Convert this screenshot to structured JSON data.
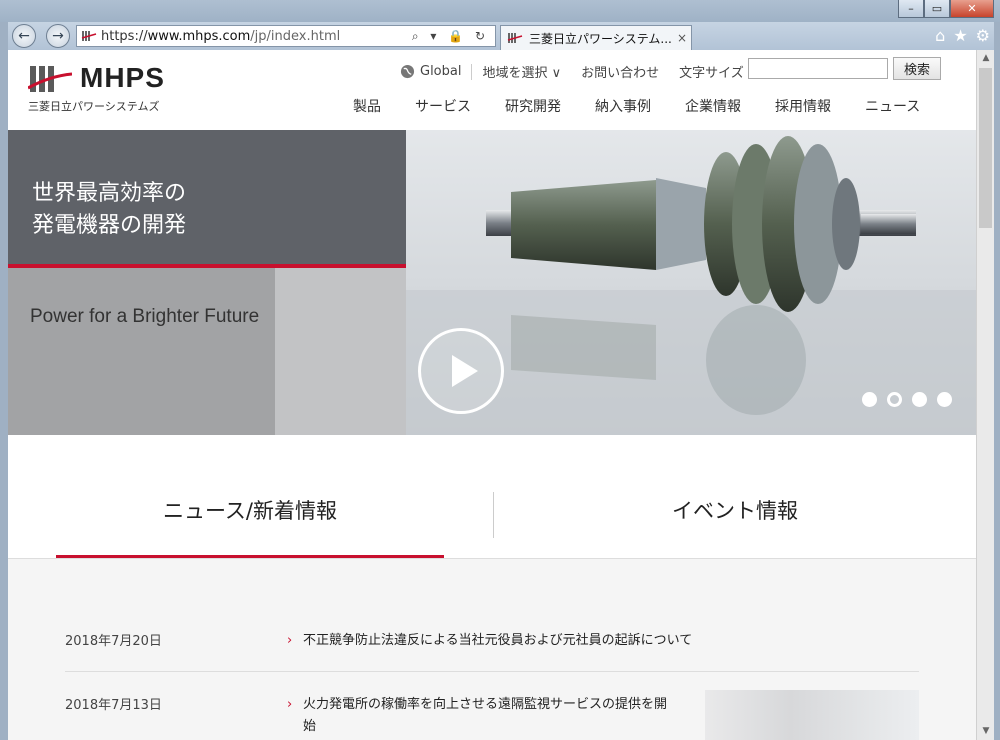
{
  "browser": {
    "url_scheme": "https://",
    "url_domain": "www.mhps.com",
    "url_path": "/jp/index.html",
    "address_icons": "⌕ ▾ 🔒 ↻",
    "tab_title": "三菱日立パワーシステム...",
    "tab_close": "×",
    "back": "←",
    "forward": "→",
    "toolbar_icons": {
      "home": "⌂",
      "favorites": "★",
      "tools": "⚙"
    },
    "window_controls": {
      "minimize": "–",
      "maximize": "▭",
      "close": "✕"
    }
  },
  "header": {
    "logo_text": "MHPS",
    "logo_subtitle": "三菱日立パワーシステムズ",
    "util_links": {
      "global": "Global",
      "region": "地域を選択 ∨",
      "contact": "お問い合わせ",
      "font_size": "文字サイズ"
    },
    "search": {
      "value": "",
      "placeholder": "",
      "button": "検索"
    },
    "nav": [
      "製品",
      "サービス",
      "研究開発",
      "納入事例",
      "企業情報",
      "採用情報",
      "ニュース"
    ]
  },
  "hero": {
    "title": "世界最高効率の\n発電機器の開発",
    "tagline": "Power for a Brighter Future",
    "slide_count": 4,
    "active_slide": 2
  },
  "tabs": {
    "news": "ニュース/新着情報",
    "events": "イベント情報"
  },
  "news": [
    {
      "date": "2018年7月20日",
      "title": "不正競争防止法違反による当社元役員および元社員の起訴について"
    },
    {
      "date": "2018年7月13日",
      "title": "火力発電所の稼働率を向上させる遠隔監視サービスの提供を開始"
    }
  ],
  "colors": {
    "accent": "#c8102e",
    "hero_dark": "#5f6268"
  }
}
